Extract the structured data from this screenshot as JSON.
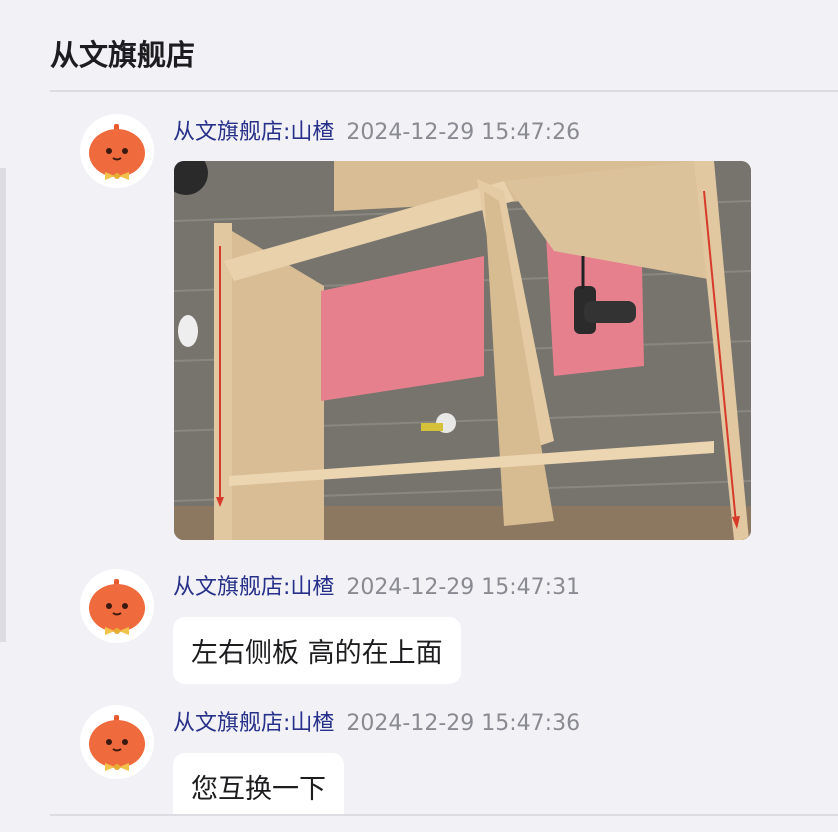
{
  "header": {
    "title": "从文旗舰店"
  },
  "messages": [
    {
      "sender": "从文旗舰店:山楂",
      "time": "2024-12-29 15:47:26",
      "type": "image"
    },
    {
      "sender": "从文旗舰店:山楂",
      "time": "2024-12-29 15:47:31",
      "type": "text",
      "text": "左右侧板  高的在上面"
    },
    {
      "sender": "从文旗舰店:山楂",
      "time": "2024-12-29 15:47:36",
      "type": "text",
      "text": "您互换一下"
    }
  ],
  "colors": {
    "sender": "#27318a",
    "time": "#8a8a92",
    "avatar": "#ef6a3c",
    "background": "#f2f2f6"
  },
  "icons": {
    "avatar": "orange-mascot-avatar"
  }
}
